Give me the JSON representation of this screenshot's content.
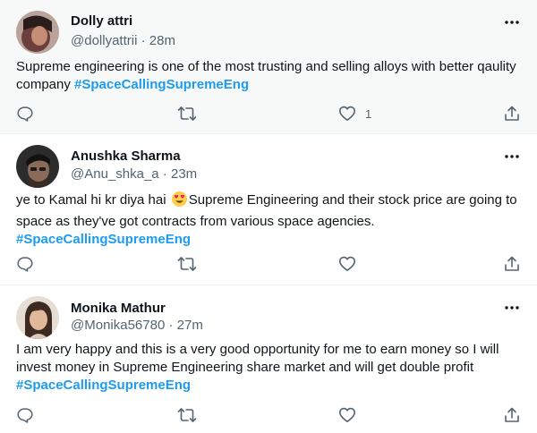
{
  "tweets": [
    {
      "name": "Dolly attri",
      "handle": "@dollyattrii",
      "time": "28m",
      "text_before": "Supreme engineering is one of the most trusting and selling alloys with better qaulity company ",
      "text_mid": "",
      "text_after": "",
      "hashtag": "#SpaceCallingSupremeEng",
      "like_count": "1",
      "avatar_color": "#3a2a2a"
    },
    {
      "name": "Anushka Sharma",
      "handle": "@Anu_shka_a",
      "time": "23m",
      "text_before": "ye to Kamal hi kr diya hai ",
      "text_mid": "Supreme Engineering and their stock price are going to space as they've got contracts from various space agencies.",
      "text_after": "",
      "hashtag": "#SpaceCallingSupremeEng",
      "like_count": "",
      "avatar_color": "#1f1f1f"
    },
    {
      "name": "Monika Mathur",
      "handle": "@Monika56780",
      "time": "27m",
      "text_before": "I am very happy and this is a very good opportunity for me to earn money so I will invest money in Supreme Engineering share market and will get double profit",
      "text_mid": "",
      "text_after": "",
      "hashtag": "#SpaceCallingSupremeEng",
      "like_count": "",
      "avatar_color": "#c9b29a"
    }
  ],
  "meta_separator": " · ",
  "colors": {
    "accent": "#1d9bf0",
    "secondary_text": "#536471",
    "primary_text": "#0f1419"
  },
  "icons": {
    "more": "more-horizontal-icon",
    "reply": "reply-bubble-icon",
    "retweet": "retweet-icon",
    "like": "heart-icon",
    "share": "share-upload-icon",
    "emoji": "heart-eyes-emoji"
  }
}
